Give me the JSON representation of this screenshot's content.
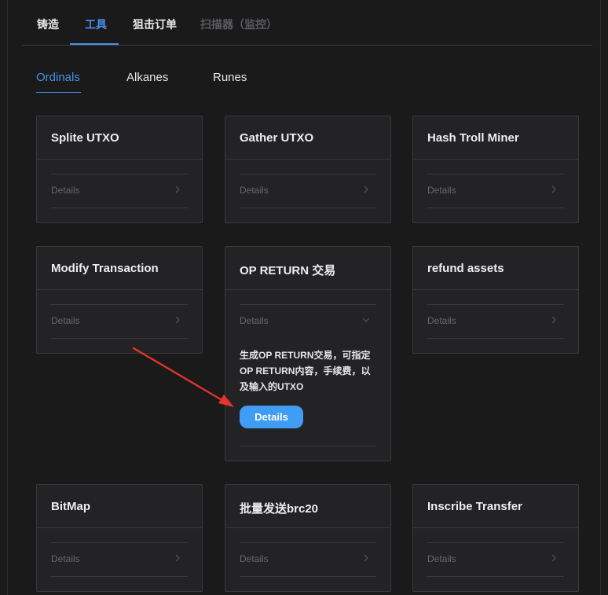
{
  "top_tabs": [
    {
      "label": "铸造"
    },
    {
      "label": "工具"
    },
    {
      "label": "狙击订单"
    },
    {
      "label": "扫描器（监控）"
    }
  ],
  "sub_tabs": [
    {
      "label": "Ordinals"
    },
    {
      "label": "Alkanes"
    },
    {
      "label": "Runes"
    }
  ],
  "cards": [
    {
      "title": "Splite UTXO",
      "details_label": "Details"
    },
    {
      "title": "Gather UTXO",
      "details_label": "Details"
    },
    {
      "title": "Hash Troll Miner",
      "details_label": "Details"
    },
    {
      "title": "Modify Transaction",
      "details_label": "Details"
    },
    {
      "title": "OP RETURN 交易",
      "details_label": "Details",
      "description": "生成OP RETURN交易，可指定OP RETURN内容，手续费，以及输入的UTXO",
      "button_label": "Details"
    },
    {
      "title": "refund assets",
      "details_label": "Details"
    },
    {
      "title": "BitMap",
      "details_label": "Details"
    },
    {
      "title": "批量发送brc20",
      "details_label": "Details"
    },
    {
      "title": "Inscribe Transfer",
      "details_label": "Details"
    }
  ],
  "colors": {
    "accent": "#4a90e8",
    "button": "#3f9df5",
    "annotation_arrow": "#e8352a"
  },
  "icons": [
    "chevron-right-icon",
    "chevron-down-icon"
  ]
}
